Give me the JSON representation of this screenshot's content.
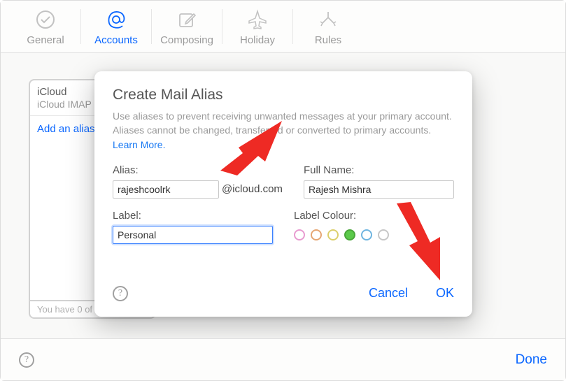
{
  "toolbar": {
    "items": [
      {
        "label": "General"
      },
      {
        "label": "Accounts"
      },
      {
        "label": "Composing"
      },
      {
        "label": "Holiday"
      },
      {
        "label": "Rules"
      }
    ]
  },
  "sidebar": {
    "account_name": "iCloud",
    "account_sub": "iCloud IMAP",
    "add_alias": "Add an alias…",
    "footer": "You have 0 of 3 aliases"
  },
  "modal": {
    "title": "Create Mail Alias",
    "desc_part1": "Use aliases to prevent receiving unwanted messages at your primary account. Aliases cannot be changed, transferred or converted to primary accounts. ",
    "learn_more": "Learn More.",
    "alias_label": "Alias:",
    "alias_value": "rajeshcoolrk",
    "alias_domain": "@icloud.com",
    "fullname_label": "Full Name:",
    "fullname_value": "Rajesh Mishra",
    "label_label": "Label:",
    "label_value": "Personal",
    "colour_label": "Label Colour:",
    "colours": [
      "pink",
      "orange",
      "yellow",
      "green",
      "blue",
      "grey"
    ],
    "selected_colour": "green",
    "cancel": "Cancel",
    "ok": "OK"
  },
  "footer": {
    "done": "Done"
  }
}
